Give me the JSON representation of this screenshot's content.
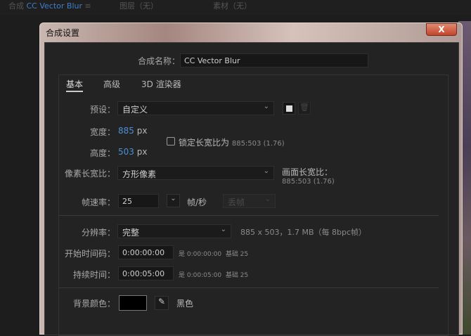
{
  "topbar": {
    "comp_prefix": "合成",
    "comp_name": "CC Vector Blur",
    "layer": "图层（无）",
    "footage": "素材（无）"
  },
  "dialog": {
    "title": "合成设置",
    "close": "X",
    "name_label": "合成名称：",
    "name_value": "CC Vector Blur",
    "tabs": [
      "基本",
      "高级",
      "3D 渲染器"
    ],
    "preset_label": "预设：",
    "preset_value": "自定义",
    "width_label": "宽度：",
    "width_value": "885",
    "height_label": "高度：",
    "height_value": "503",
    "unit": "px",
    "lock_label": "锁定长宽比为",
    "lock_value": "885:503 (1.76)",
    "lock_checked": false,
    "par_label": "像素长宽比：",
    "par_value": "方形像素",
    "frame_ar_label": "画面长宽比：",
    "frame_ar_value": "885:503 (1.76)",
    "fps_label": "帧速率：",
    "fps_value": "25",
    "fps_unit": "帧/秒",
    "drop_frame": "丢帧",
    "res_label": "分辨率：",
    "res_value": "完整",
    "res_info": "885 x 503，1.7 MB（每 8bpc帧）",
    "start_label": "开始时间码：",
    "start_value": "0:00:00:00",
    "start_info_prefix": "是",
    "start_info": "0:00:00:00",
    "base_label": "基础 25",
    "dur_label": "持续时间：",
    "dur_value": "0:00:05:00",
    "dur_info": "0:00:05:00",
    "bg_label": "背景颜色：",
    "bg_color": "#000000",
    "bg_name": "黑色"
  }
}
